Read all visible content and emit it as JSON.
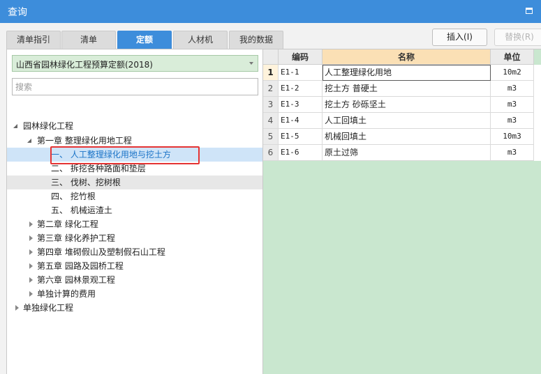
{
  "window": {
    "title": "查询"
  },
  "tabs": [
    {
      "label": "清单指引",
      "active": false
    },
    {
      "label": "清单",
      "active": false
    },
    {
      "label": "定额",
      "active": true
    },
    {
      "label": "人材机",
      "active": false
    },
    {
      "label": "我的数据",
      "active": false
    }
  ],
  "toolbar": {
    "insert_label": "插入(I)",
    "replace_label": "替换(R)"
  },
  "quota_library": {
    "selected": "山西省园林绿化工程预算定额(2018)"
  },
  "search": {
    "placeholder": "搜索",
    "value": ""
  },
  "tree": [
    {
      "label": "园林绿化工程",
      "state": "expanded"
    },
    {
      "label": "第一章  整理绿化用地工程",
      "state": "expanded"
    },
    {
      "label": "一、  人工整理绿化用地与挖土方",
      "state": "leaf",
      "selected": true,
      "highlighted": true
    },
    {
      "label": "二、  拆挖各种路面和垫层",
      "state": "leaf"
    },
    {
      "label": "三、  伐树、挖树根",
      "state": "leaf",
      "hover": true
    },
    {
      "label": "四、  挖竹根",
      "state": "leaf"
    },
    {
      "label": "五、  机械运渣土",
      "state": "leaf"
    },
    {
      "label": "第二章  绿化工程",
      "state": "collapsed"
    },
    {
      "label": "第三章  绿化养护工程",
      "state": "collapsed"
    },
    {
      "label": "第四章  堆砌假山及塑制假石山工程",
      "state": "collapsed"
    },
    {
      "label": "第五章  园路及园桥工程",
      "state": "collapsed"
    },
    {
      "label": "第六章  园林景观工程",
      "state": "collapsed"
    },
    {
      "label": "单独计算的费用",
      "state": "collapsed"
    },
    {
      "label": "单独绿化工程",
      "state": "collapsed"
    }
  ],
  "table": {
    "columns": [
      "编码",
      "名称",
      "单位"
    ],
    "rows": [
      {
        "num": "1",
        "code": "E1-1",
        "name": "人工整理绿化用地",
        "unit": "10m2"
      },
      {
        "num": "2",
        "code": "E1-2",
        "name": "挖土方 普硬土",
        "unit": "m3"
      },
      {
        "num": "3",
        "code": "E1-3",
        "name": "挖土方 砂砾坚土",
        "unit": "m3"
      },
      {
        "num": "4",
        "code": "E1-4",
        "name": "人工回填土",
        "unit": "m3"
      },
      {
        "num": "5",
        "code": "E1-5",
        "name": "机械回填土",
        "unit": "10m3"
      },
      {
        "num": "6",
        "code": "E1-6",
        "name": "原土过筛",
        "unit": "m3"
      }
    ]
  }
}
